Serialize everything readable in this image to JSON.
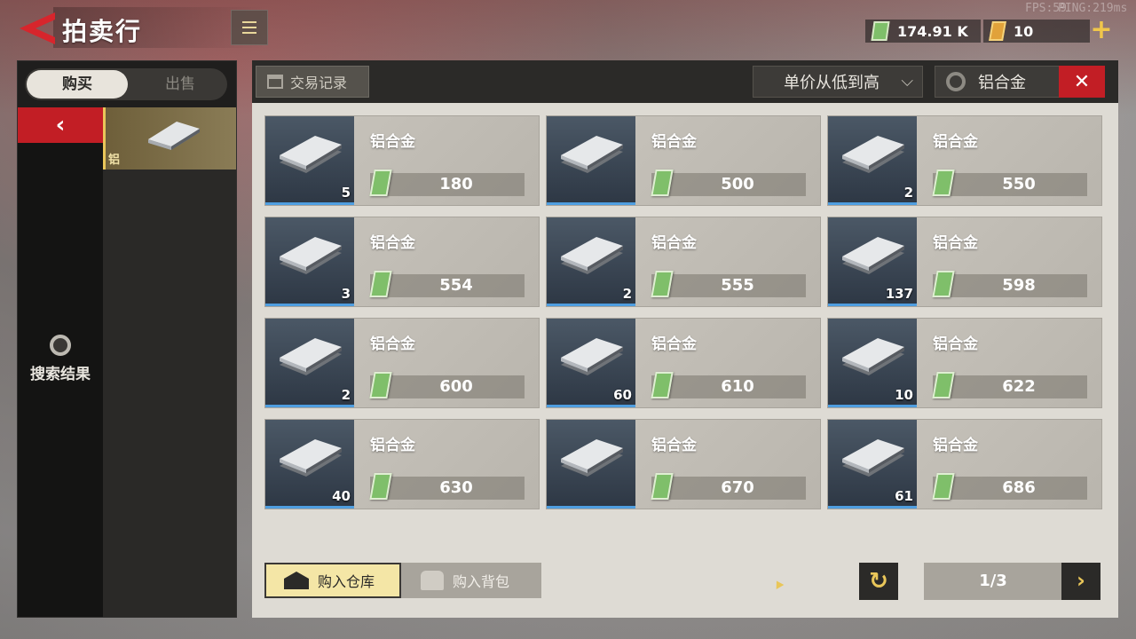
{
  "header": {
    "title": "拍卖行",
    "fps": "FPS:59",
    "ping": "PING:219ms",
    "money": "174.91 K",
    "coupons": "10",
    "plus": "+"
  },
  "left": {
    "tabs": [
      {
        "label": "购买",
        "active": true
      },
      {
        "label": "出售",
        "active": false
      }
    ],
    "back": "‹",
    "category_label": "铝",
    "search_results": "搜索结果"
  },
  "toolbar": {
    "trade_log": "交易记录",
    "sort": "单价从低到高",
    "sort_chevron": "⌵",
    "search_value": "铝合金",
    "clear": "✕"
  },
  "items": [
    {
      "name": "铝合金",
      "price": "180",
      "count": "5"
    },
    {
      "name": "铝合金",
      "price": "500",
      "count": ""
    },
    {
      "name": "铝合金",
      "price": "550",
      "count": "2"
    },
    {
      "name": "铝合金",
      "price": "554",
      "count": "3"
    },
    {
      "name": "铝合金",
      "price": "555",
      "count": "2"
    },
    {
      "name": "铝合金",
      "price": "598",
      "count": "137"
    },
    {
      "name": "铝合金",
      "price": "600",
      "count": "2"
    },
    {
      "name": "铝合金",
      "price": "610",
      "count": "60"
    },
    {
      "name": "铝合金",
      "price": "622",
      "count": "10"
    },
    {
      "name": "铝合金",
      "price": "630",
      "count": "40"
    },
    {
      "name": "铝合金",
      "price": "670",
      "count": ""
    },
    {
      "name": "铝合金",
      "price": "686",
      "count": "61"
    }
  ],
  "bottom": {
    "buy_warehouse": "购入仓库",
    "buy_bag": "购入背包",
    "refresh": "↻",
    "page": "1/3",
    "next": "›"
  },
  "colors": {
    "accent_red": "#c21e25",
    "accent_gold": "#e9c659",
    "money_green": "#7fbf6a",
    "highlight_blue": "#4f9ee0"
  }
}
